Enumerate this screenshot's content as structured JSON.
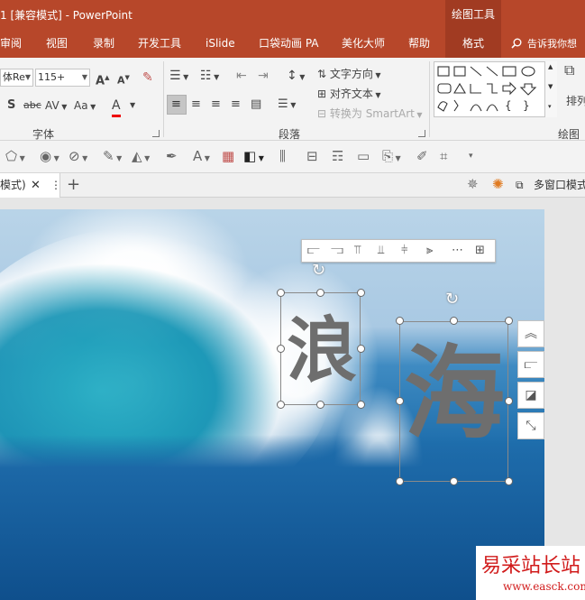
{
  "window": {
    "title": "1 [兼容模式]  -  PowerPoint",
    "context_tab": "绘图工具"
  },
  "tabs": [
    {
      "label": "审阅"
    },
    {
      "label": "视图"
    },
    {
      "label": "录制"
    },
    {
      "label": "开发工具"
    },
    {
      "label": "iSlide"
    },
    {
      "label": "口袋动画 PA"
    },
    {
      "label": "美化大师"
    },
    {
      "label": "帮助"
    },
    {
      "label": "格式"
    }
  ],
  "tell_me": "告诉我你想",
  "font_group": {
    "font_name": "体Re",
    "font_size": "115+",
    "label": "字体"
  },
  "paragraph_group": {
    "text_direction": "文字方向",
    "align_text": "对齐文本",
    "convert_smartart": "转换为 SmartArt",
    "label": "段落"
  },
  "drawing_group": {
    "arrange_label": "排列",
    "label": "绘图"
  },
  "document_tab": {
    "label": "模式)"
  },
  "multi_window": "多窗口模式",
  "slide": {
    "chars": [
      "浪",
      "海"
    ]
  },
  "watermark": {
    "line1": "易采站长站",
    "line2": "www.easck.com"
  },
  "colors": {
    "accent": "#b7472a",
    "context_tab_bg": "#a13b22"
  }
}
